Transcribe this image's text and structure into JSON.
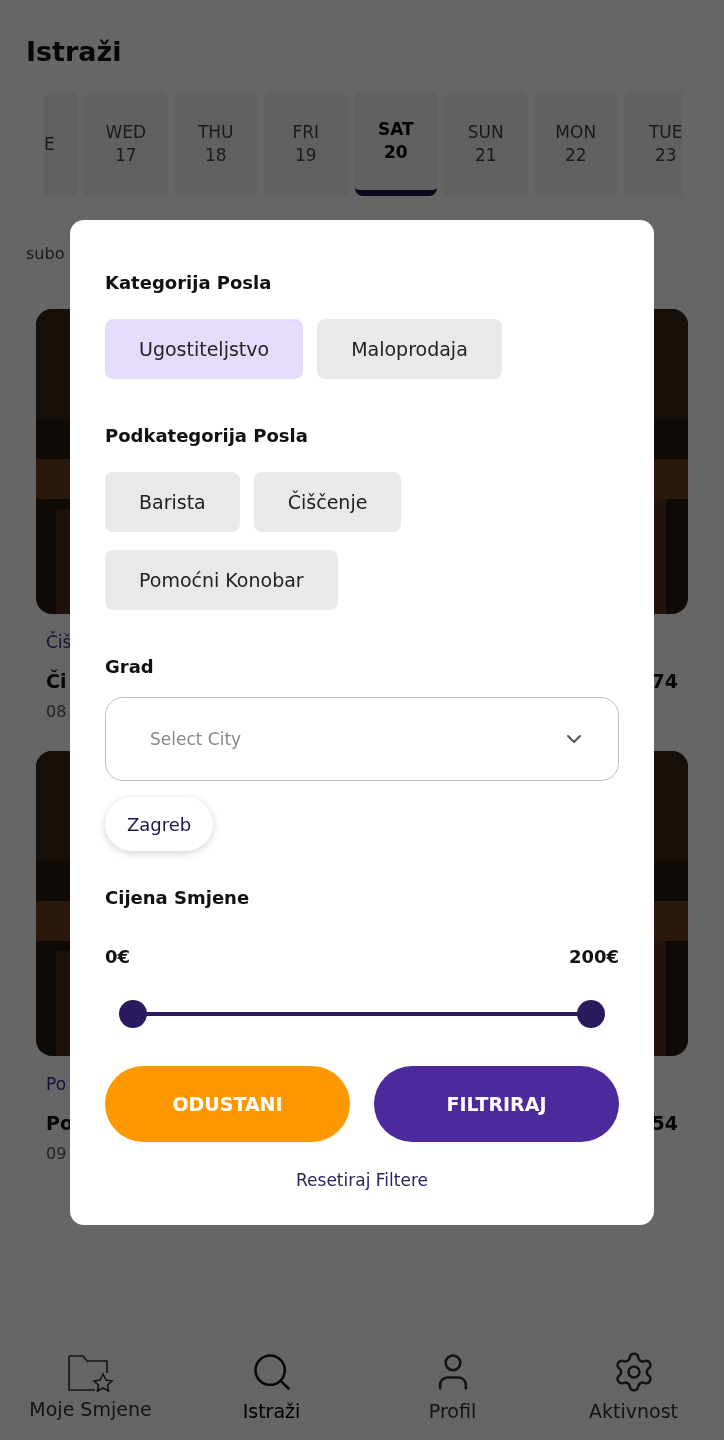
{
  "header": {
    "title": "Istraži"
  },
  "dates": [
    {
      "day": "E",
      "selected": false
    },
    {
      "day": "WED",
      "date": "17",
      "selected": false
    },
    {
      "day": "THU",
      "date": "18",
      "selected": false
    },
    {
      "day": "FRI",
      "date": "19",
      "selected": false
    },
    {
      "day": "SAT",
      "date": "20",
      "selected": true
    },
    {
      "day": "SUN",
      "date": "21",
      "selected": false
    },
    {
      "day": "MON",
      "date": "22",
      "selected": false
    },
    {
      "day": "TUE",
      "date": "23",
      "selected": false
    }
  ],
  "date_caption": "subo",
  "cards": [
    {
      "category": "Čiš",
      "title": "Či",
      "price": "74",
      "time": "08"
    },
    {
      "category": "Po",
      "title": "Po",
      "price": "54",
      "time": "09"
    }
  ],
  "filter_dialog": {
    "category_heading": "Kategorija Posla",
    "categories": [
      {
        "label": "Ugostiteljstvo",
        "selected": true
      },
      {
        "label": "Maloprodaja",
        "selected": false
      }
    ],
    "subcategory_heading": "Podkategorija Posla",
    "subcategories": [
      {
        "label": "Barista",
        "selected": false
      },
      {
        "label": "Čiščenje",
        "selected": false
      },
      {
        "label": "Pomoćni Konobar",
        "selected": false
      }
    ],
    "city_heading": "Grad",
    "city_select": {
      "placeholder": "Select City"
    },
    "city_tags": [
      "Zagreb"
    ],
    "price_heading": "Cijena Smjene",
    "price_min": "0€",
    "price_max": "200€",
    "price_slider": {
      "thumbs": [
        {
          "level": 0
        },
        {
          "level": 1
        }
      ]
    },
    "buttons": [
      {
        "label": "ODUSTANI",
        "kind": "cancel"
      },
      {
        "label": "FILTRIRAJ",
        "kind": "apply"
      }
    ],
    "reset_link": "Resetiraj Filtere"
  },
  "nav": [
    {
      "label": "Moje Smjene",
      "kind": "folder",
      "selected": false
    },
    {
      "label": "Istraži",
      "kind": "search",
      "selected": true
    },
    {
      "label": "Profil",
      "kind": "user",
      "selected": false
    },
    {
      "label": "Aktivnost",
      "kind": "gear",
      "selected": false
    }
  ]
}
